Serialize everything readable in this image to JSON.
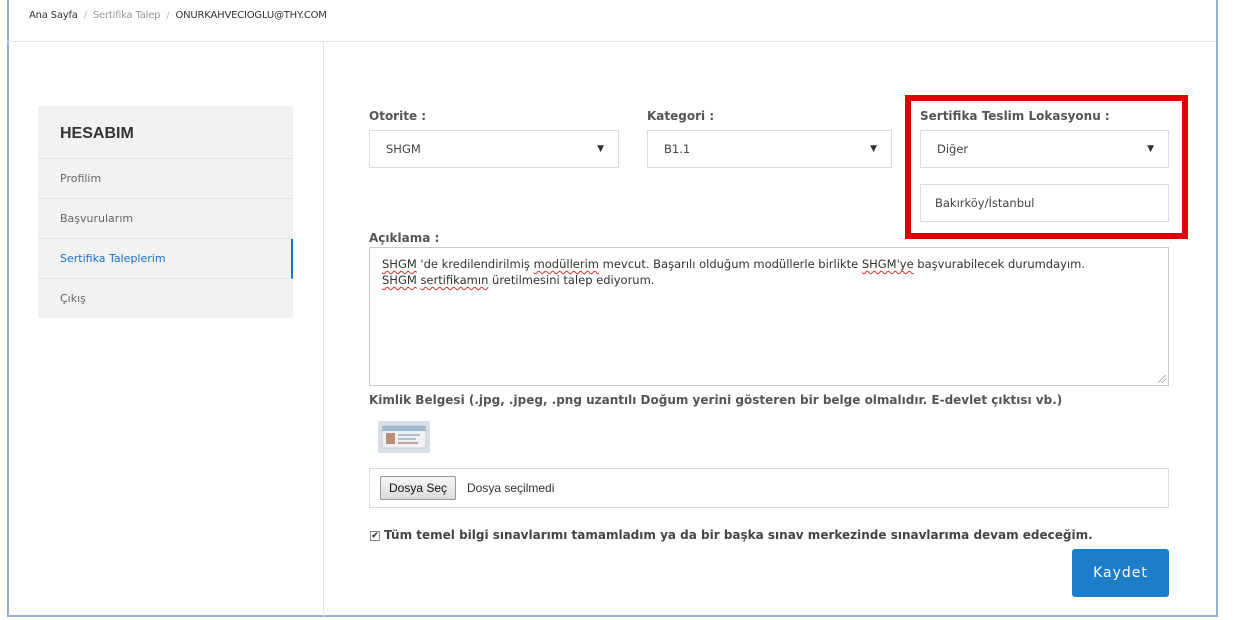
{
  "breadcrumb": {
    "home": "Ana Sayfa",
    "request": "Sertifika Talep",
    "user": "ONURKAHVECIOGLU@THY.COM"
  },
  "sidebar": {
    "title": "HESABIM",
    "items": [
      {
        "label": "Profilim"
      },
      {
        "label": "Başvurularım"
      },
      {
        "label": "Sertifika Taleplerim",
        "active": true
      },
      {
        "label": "Çıkış"
      }
    ]
  },
  "form": {
    "authority_label": "Otorite :",
    "authority_value": "SHGM",
    "category_label": "Kategori :",
    "category_value": "B1.1",
    "location_label": "Sertifika Teslim Lokasyonu :",
    "location_value": "Diğer",
    "location_other_value": "Bakırköy/İstanbul",
    "description_label": "Açıklama :",
    "description_text": {
      "l1_a": "SHGM",
      "l1_b": " 'de kredilendirilmiş ",
      "l1_c": "modüllerim",
      "l1_d": " mevcut. Başarılı olduğum modüllerle birlikte ",
      "l1_e": "SHGM'ye",
      "l1_f": " başvurabilecek durumdayım.",
      "l2_a": "SHGM",
      "l2_b": " ",
      "l2_c": "sertifikamın",
      "l2_d": " üretilmesini talep ediyorum."
    },
    "id_doc_label": "Kimlik Belgesi (.jpg, .jpeg, .png uzantılı Doğum yerini gösteren bir belge olmalıdır. E-devlet çıktısı vb.)",
    "file_button": "Dosya Seç",
    "file_status": "Dosya seçilmedi",
    "confirm_label": "Tüm temel bilgi sınavlarımı tamamladım ya da bir başka sınav merkezinde sınavlarıma devam edeceğim.",
    "confirm_checked": true,
    "save_label": "Kaydet"
  },
  "colors": {
    "accent": "#1e7dc8",
    "highlight": "#e10000",
    "active_item": "#1a73c5"
  }
}
